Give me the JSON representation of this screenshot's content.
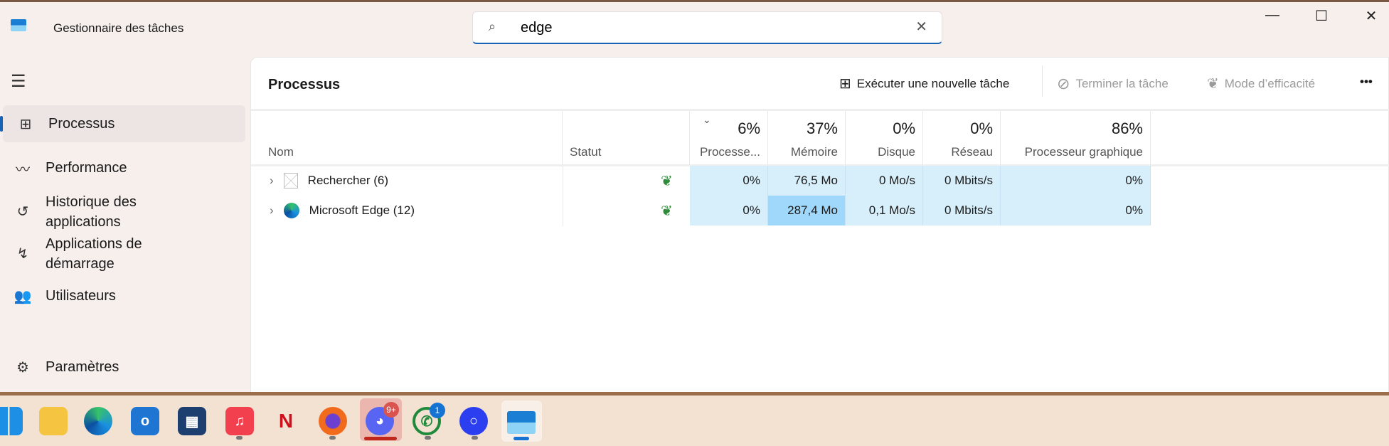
{
  "window": {
    "title": "Gestionnaire des tâches",
    "minimize": "—",
    "maximize": "☐",
    "close": "✕"
  },
  "search": {
    "value": "edge",
    "placeholder": "",
    "clear": "✕"
  },
  "sidebar": {
    "items": [
      {
        "label": "Processus",
        "icon": "processes-icon"
      },
      {
        "label": "Performance",
        "icon": "performance-icon"
      },
      {
        "label": "Historique des applications",
        "icon": "history-icon"
      },
      {
        "label": "Applications de démarrage",
        "icon": "startup-icon"
      },
      {
        "label": "Utilisateurs",
        "icon": "users-icon"
      }
    ],
    "settings": "Paramètres"
  },
  "toolbar": {
    "title": "Processus",
    "run_new": "Exécuter une nouvelle tâche",
    "end_task": "Terminer la tâche",
    "efficiency": "Mode d’efficacité",
    "more": "•••"
  },
  "table": {
    "columns": [
      {
        "label": "Nom",
        "pct": ""
      },
      {
        "label": "Statut",
        "pct": ""
      },
      {
        "label": "Processe...",
        "pct": "6%"
      },
      {
        "label": "Mémoire",
        "pct": "37%"
      },
      {
        "label": "Disque",
        "pct": "0%"
      },
      {
        "label": "Réseau",
        "pct": "0%"
      },
      {
        "label": "Processeur graphique",
        "pct": "86%"
      }
    ],
    "rows": [
      {
        "name": "Rechercher (6)",
        "cpu": "0%",
        "mem": "76,5 Mo",
        "disk": "0 Mo/s",
        "net": "0 Mbits/s",
        "gpu": "0%"
      },
      {
        "name": "Microsoft Edge (12)",
        "cpu": "0%",
        "mem": "287,4 Mo",
        "disk": "0,1 Mo/s",
        "net": "0 Mbits/s",
        "gpu": "0%"
      }
    ]
  },
  "taskbar": {
    "badges": {
      "discord": "9+",
      "whatsapp": "1"
    }
  },
  "colors": {
    "accent": "#1763b5",
    "highlight": "#d7effb",
    "hot": "#9fd8fb"
  }
}
